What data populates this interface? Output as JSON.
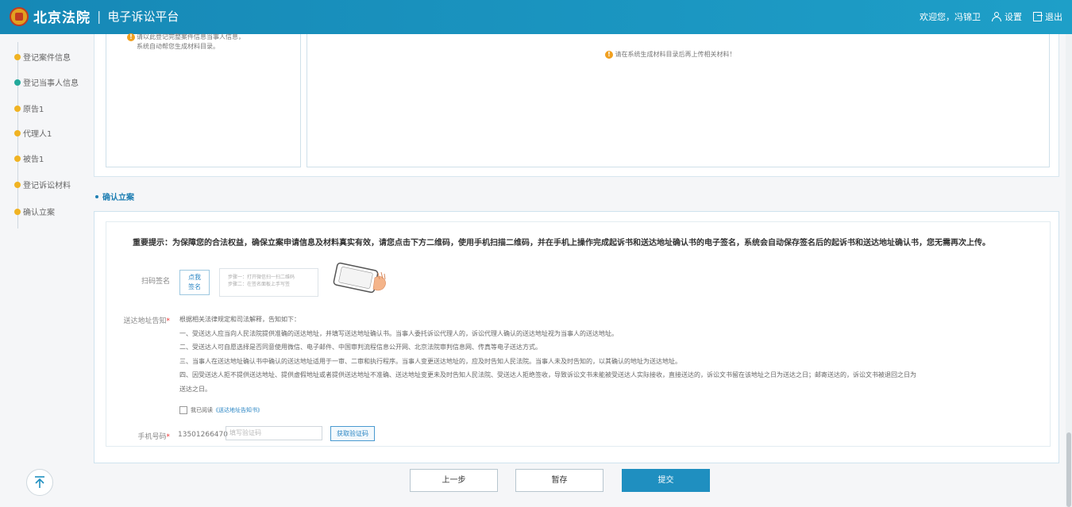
{
  "header": {
    "brand": "北京法院",
    "separator": "|",
    "platform": "电子诉讼平台",
    "welcome": "欢迎您，冯锦卫",
    "settings_label": "设置",
    "logout_label": "退出"
  },
  "steps": [
    {
      "label": "登记案件信息",
      "state": "done"
    },
    {
      "label": "登记当事人信息",
      "state": "current"
    },
    {
      "label": "原告1",
      "state": "done"
    },
    {
      "label": "代理人1",
      "state": "done"
    },
    {
      "label": "被告1",
      "state": "done"
    },
    {
      "label": "登记诉讼材料",
      "state": "done"
    },
    {
      "label": "确认立案",
      "state": "done"
    }
  ],
  "upper": {
    "left_tip_line1": "请以此登记完整案件信息当事人信息，",
    "left_tip_line2": "系统自动帮您生成材料目录。",
    "right_tip": "请在系统生成材料目录后再上传相关材料！"
  },
  "section_title": "确认立案",
  "confirm": {
    "notice_bold": "重要提示：",
    "notice_text": "为保障您的合法权益，确保立案申请信息及材料真实有效，请您点击下方二维码，使用手机扫描二维码，并在手机上操作完成起诉书和送达地址确认书的电子签名，系统会自动保存签名后的起诉书和送达地址确认书，您无需再次上传。",
    "scan_label": "扫码签名",
    "qr_button_line1": "点我",
    "qr_button_line2": "签名",
    "qr_step1": "步骤一：打开微信扫一扫二维码",
    "qr_step2": "步骤二：在签名面板上手写签",
    "address_label": "送达地址告知",
    "law_lines": [
      "根据相关法律规定和司法解释，告知如下：",
      "一、受送达人应当向人民法院提供准确的送达地址，并填写送达地址确认书。当事人委托诉讼代理人的，诉讼代理人确认的送达地址视为当事人的送达地址。",
      "二、受送达人可自愿选择是否同意使用微信、电子邮件、中国审判流程信息公开网、北京法院审判信息网、传真等电子送达方式。",
      "三、当事人在送达地址确认书中确认的送达地址适用于一审、二审和执行程序。当事人变更送达地址的，应及时告知人民法院。当事人未及时告知的，以其确认的地址为送达地址。",
      "四、因受送达人拒不提供送达地址、提供虚假地址或者提供送达地址不准确、送达地址变更未及时告知人民法院、受送达人拒绝签收，导致诉讼文书未能被受送达人实际接收，直接送达的，诉讼文书留在该地址之日为送达之日；邮寄送达的，诉讼文书被退回之日为",
      "送达之日。"
    ],
    "agree_text": "我已阅读",
    "agree_link": "《送达地址告知书》",
    "phone_label": "手机号码",
    "phone_value": "13501266470",
    "code_placeholder": "填写验证码",
    "code_button": "获取验证码"
  },
  "buttons": {
    "prev": "上一步",
    "save": "暂存",
    "submit": "提交"
  },
  "colors": {
    "header": "#1688b6",
    "accent": "#1f8fc0",
    "step_dot": "#f0b323",
    "step_current": "#22a99b",
    "warning": "#f0a020"
  }
}
